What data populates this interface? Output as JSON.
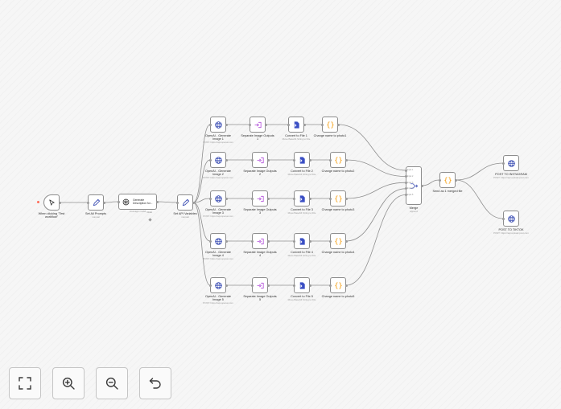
{
  "nodes": {
    "trigger": {
      "label": "When clicking \"Test\nworkflow\"",
      "icon": "cursor-icon"
    },
    "set_prompts": {
      "label": "Set All Prompts",
      "sub": "manual",
      "icon": "pencil-icon"
    },
    "gen_desc": {
      "label": "Generate\nDescription for...",
      "sub": "message model",
      "icon": "openai-icon"
    },
    "set_api": {
      "label": "Set API Variables",
      "sub": "manual",
      "icon": "pencil-icon"
    },
    "openai_1": {
      "label": "OpenAI - Generate\nImage 1",
      "sub": "POST: https://api.openai.com",
      "icon": "globe-icon"
    },
    "sep_1": {
      "label": "Separate Image Outputs\n1",
      "icon": "split-icon"
    },
    "conv_1": {
      "label": "Convert to File 1",
      "sub": "Move Base64 String to File",
      "icon": "file-icon"
    },
    "rename_1": {
      "label": "Change name to photo1",
      "icon": "code-icon"
    },
    "openai_2": {
      "label": "OpenAI - Generate\nImage 2",
      "sub": "POST: https://api.openai.com",
      "icon": "globe-icon"
    },
    "sep_2": {
      "label": "Separate Image Outputs\n2",
      "icon": "split-icon"
    },
    "conv_2": {
      "label": "Convert to File 2",
      "sub": "Move Base64 String to File",
      "icon": "file-icon"
    },
    "rename_2": {
      "label": "Change name to photo2",
      "icon": "code-icon"
    },
    "openai_3": {
      "label": "OpenAI - Generate\nImage 3",
      "sub": "POST: https://api.openai.com",
      "icon": "globe-icon"
    },
    "sep_3": {
      "label": "Separate Image Outputs\n3",
      "icon": "split-icon"
    },
    "conv_3": {
      "label": "Convert to File 3",
      "sub": "Move Base64 String to File",
      "icon": "file-icon"
    },
    "rename_3": {
      "label": "Change name to photo3",
      "icon": "code-icon"
    },
    "openai_4": {
      "label": "OpenAI - Generate\nImage 4",
      "sub": "POST: https://api.openai.com",
      "icon": "globe-icon"
    },
    "sep_4": {
      "label": "Separate Image Outputs\n4",
      "icon": "split-icon"
    },
    "conv_4": {
      "label": "Convert to File 4",
      "sub": "Move Base64 String to File",
      "icon": "file-icon"
    },
    "rename_4": {
      "label": "Change name to photo4",
      "icon": "code-icon"
    },
    "openai_5": {
      "label": "OpenAI - Generate\nImage 5",
      "sub": "POST: https://api.openai.com",
      "icon": "globe-icon"
    },
    "sep_5": {
      "label": "Separate Image Outputs\n5",
      "icon": "split-icon"
    },
    "conv_5": {
      "label": "Convert to File 5",
      "sub": "Move Base64 String to File",
      "icon": "file-icon"
    },
    "rename_5": {
      "label": "Change name to photo5",
      "icon": "code-icon"
    },
    "merge": {
      "label": "Merge",
      "sub": "append",
      "icon": "merge-icon",
      "inputs": [
        "Input 1",
        "Input 2",
        "Input 3",
        "Input 4",
        "Input 5"
      ]
    },
    "send_merged": {
      "label": "Send as 1 merged file",
      "icon": "code-icon"
    },
    "post_instagram": {
      "label": "POST TO INSTAGRAM",
      "sub": "POST: https://api.upload-post.com",
      "icon": "globe-icon"
    },
    "post_tiktok": {
      "label": "POST TO TIKTOK",
      "sub": "POST: https://api.upload-post.com",
      "icon": "globe-icon"
    }
  },
  "model_port_label": "Model",
  "controls": [
    {
      "name": "fit-view-button",
      "icon": "fullscreen-icon"
    },
    {
      "name": "zoom-in-button",
      "icon": "zoom-in-icon"
    },
    {
      "name": "zoom-out-button",
      "icon": "zoom-out-icon"
    },
    {
      "name": "undo-button",
      "icon": "undo-icon"
    }
  ],
  "colors": {
    "canvas_bg": "#f6f6f6",
    "edge": "#8f8f8f",
    "trigger_dot": "#ff6d5a",
    "globe": "#3f51b5",
    "split": "#b04bd9",
    "file": "#3b4fc4",
    "code": "#f5a623"
  }
}
